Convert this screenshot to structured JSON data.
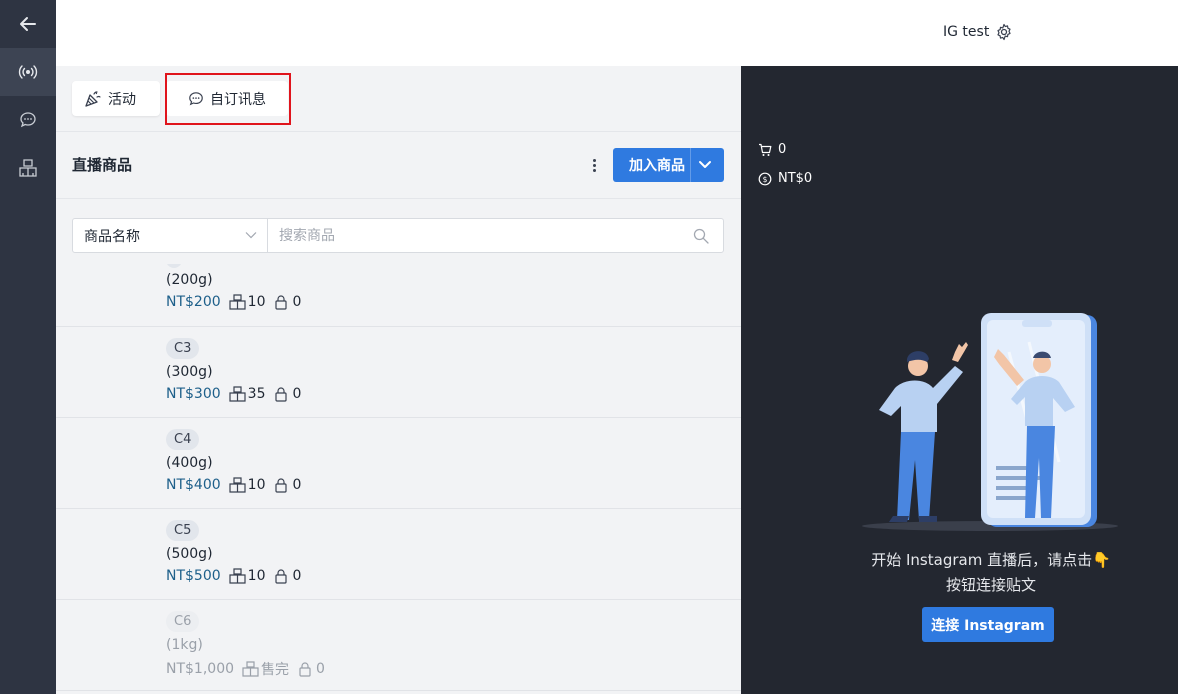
{
  "header": {
    "account_name": "IG test"
  },
  "tabs": {
    "activity_label": "活动",
    "custom_message_label": "自订讯息"
  },
  "products": {
    "title": "直播商品",
    "add_button_label": "加入商品",
    "filter_field": "商品名称",
    "search_placeholder": "搜索商品",
    "items": [
      {
        "badge": "",
        "weight": "(200g)",
        "price": "NT$200",
        "stock": "10",
        "locked": "0",
        "sold_out": false
      },
      {
        "badge": "C3",
        "weight": "(300g)",
        "price": "NT$300",
        "stock": "35",
        "locked": "0",
        "sold_out": false
      },
      {
        "badge": "C4",
        "weight": "(400g)",
        "price": "NT$400",
        "stock": "10",
        "locked": "0",
        "sold_out": false
      },
      {
        "badge": "C5",
        "weight": "(500g)",
        "price": "NT$500",
        "stock": "10",
        "locked": "0",
        "sold_out": false
      },
      {
        "badge": "C6",
        "weight": "(1kg)",
        "price": "NT$1,000",
        "stock": "售完",
        "locked": "0",
        "sold_out": true
      }
    ]
  },
  "live": {
    "cart_count": "0",
    "revenue": "NT$0",
    "hint_line1": "开始 Instagram 直播后，请点击👇",
    "hint_line2": "按钮连接贴文",
    "connect_button_label": "连接 Instagram"
  },
  "colors": {
    "accent": "#2f7ae0",
    "rail": "#2e3442",
    "dark_panel": "#232730",
    "price": "#1d5f8a",
    "highlight": "#e0141c"
  }
}
